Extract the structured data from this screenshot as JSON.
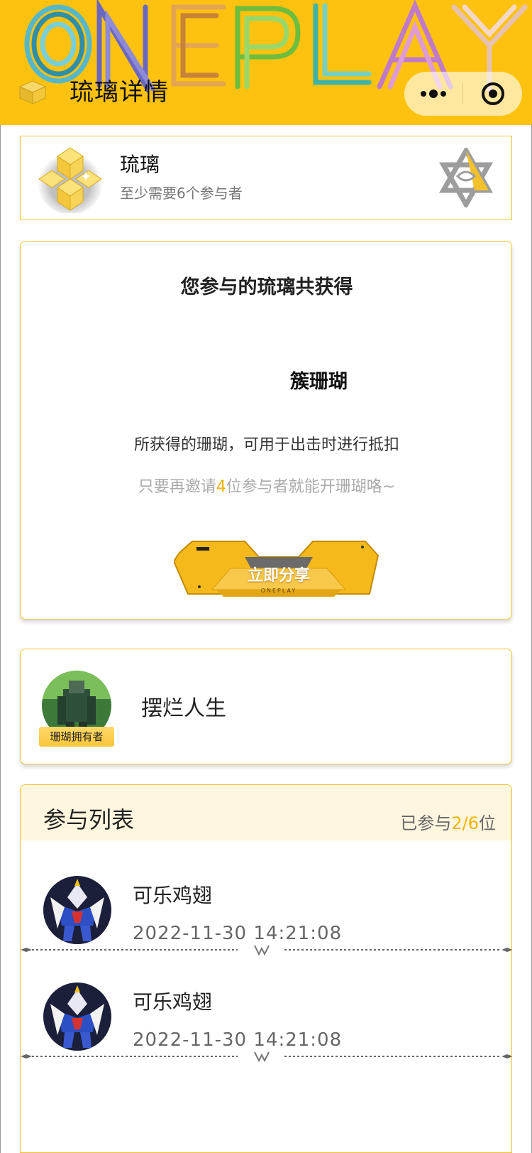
{
  "header": {
    "brand_logo_text": "ONEPLAY",
    "title": "琉璃详情",
    "back_icon": "back-chevron-icon",
    "more_icon": "more-dots-icon",
    "capsule_target_icon": "target-icon"
  },
  "summary": {
    "name": "琉璃",
    "requirement": "至少需要6个参与者",
    "icon": "gem-cluster-icon",
    "badge_icon": "star-badge-icon"
  },
  "reward": {
    "title": "您参与的琉璃共获得",
    "amount_text": "簇珊瑚",
    "description": "所获得的珊瑚，可用于出击时进行抵扣",
    "invite_prefix": "只要再邀请",
    "invite_count": "4",
    "invite_suffix": "位参与者就能开珊瑚咯~",
    "share_button_label": "立即分享",
    "share_button_brand": "ONEPLAY"
  },
  "owner": {
    "tag": "珊瑚拥有者",
    "name": "摆烂人生"
  },
  "participants": {
    "title": "参与列表",
    "count_prefix": "已参与",
    "count_value": "2/6",
    "count_suffix": "位",
    "items": [
      {
        "name": "可乐鸡翅",
        "time": "2022-11-30 14:21:08"
      },
      {
        "name": "可乐鸡翅",
        "time": "2022-11-30 14:21:08"
      }
    ]
  },
  "colors": {
    "accent": "#fcc20f",
    "highlight": "#f7b500",
    "card_border": "#f1c232",
    "list_header_bg": "#fff6df"
  }
}
